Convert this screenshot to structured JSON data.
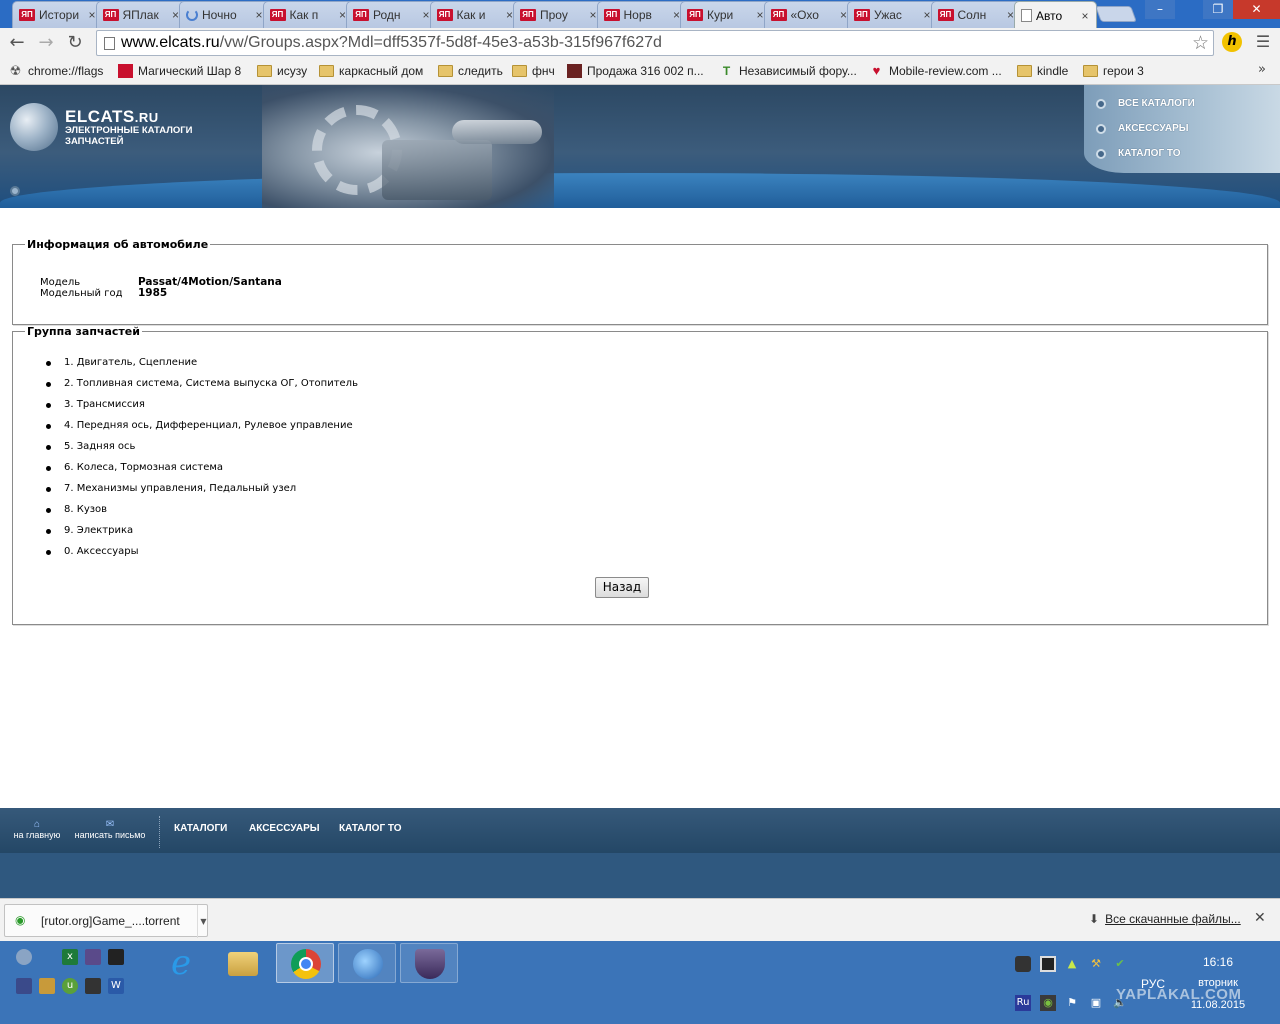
{
  "browser": {
    "tabs": [
      {
        "label": "Истори",
        "icon": "yap"
      },
      {
        "label": "ЯПлак",
        "icon": "yap"
      },
      {
        "label": "Ночно",
        "icon": "loading"
      },
      {
        "label": "Как п",
        "icon": "yap"
      },
      {
        "label": "Родн",
        "icon": "yap"
      },
      {
        "label": "Как и",
        "icon": "yap"
      },
      {
        "label": "Проу",
        "icon": "yap"
      },
      {
        "label": "Норв",
        "icon": "yap"
      },
      {
        "label": "Кури",
        "icon": "yap"
      },
      {
        "label": "«Охо",
        "icon": "yap"
      },
      {
        "label": "Ужас",
        "icon": "yap"
      },
      {
        "label": "Солн",
        "icon": "yap"
      },
      {
        "label": "Авто",
        "icon": "page"
      }
    ],
    "yap_badge": "ЯП",
    "close_glyph": "×",
    "url_domain": "www.elcats.ru",
    "url_path": "/vw/Groups.aspx?Mdl=dff5357f-5d8f-45e3-a53b-315f967f627d",
    "ext_letter": "h",
    "bookmarks": [
      {
        "label": "chrome://flags",
        "icon": "radio"
      },
      {
        "label": "Магический Шар 8",
        "icon": "red"
      },
      {
        "label": "исузу",
        "icon": "folder"
      },
      {
        "label": "каркасный дом",
        "icon": "folder"
      },
      {
        "label": "следить",
        "icon": "folder"
      },
      {
        "label": "фнч",
        "icon": "folder"
      },
      {
        "label": "Продажа 316 002 п...",
        "icon": "dark"
      },
      {
        "label": "Независимый фору...",
        "icon": "green"
      },
      {
        "label": "Mobile-review.com ...",
        "icon": "mr"
      },
      {
        "label": "kindle",
        "icon": "folder"
      },
      {
        "label": "герои 3",
        "icon": "folder"
      }
    ],
    "bookmarks_more": "»"
  },
  "site": {
    "logo_main": "ELCATS",
    "logo_tld": ".RU",
    "logo_sub": "ЭЛЕКТРОННЫЕ КАТАЛОГИ ЗАПЧАСТЕЙ",
    "top_menu": [
      "ВСЕ КАТАЛОГИ",
      "АКСЕССУАРЫ",
      "КАТАЛОГ ТО"
    ],
    "info_legend": "Информация об автомобиле",
    "info": [
      {
        "label": "Модель",
        "value": "Passat/4Motion/Santana"
      },
      {
        "label": "Модельный год",
        "value": "1985"
      }
    ],
    "groups_legend": "Группа запчастей",
    "groups": [
      "1. Двигатель, Сцепление",
      "2. Топливная система, Система выпуска ОГ, Отопитель",
      "3. Трансмиссия",
      "4. Передняя ось, Дифференциал, Рулевое управление",
      "5. Задняя ось",
      "6. Колеса, Тормозная система",
      "7. Механизмы управления, Педальный узел",
      "8. Кузов",
      "9. Электрика",
      "0. Аксессуары"
    ],
    "back_label": "Назад",
    "footer_home": "на главную",
    "footer_mail": "написать письмо",
    "footer_links": [
      "КАТАЛОГИ",
      "АКСЕССУАРЫ",
      "КАТАЛОГ ТО"
    ]
  },
  "downloads": {
    "file_name": "[rutor.org]Game_....torrent",
    "show_all": "Все скачанные файлы..."
  },
  "taskbar": {
    "language": "РУС",
    "time": "16:16",
    "day": "вторник",
    "date": "11.08.2015",
    "lang_badge": "Ru"
  },
  "watermark": "YAPLAKAL.COM"
}
